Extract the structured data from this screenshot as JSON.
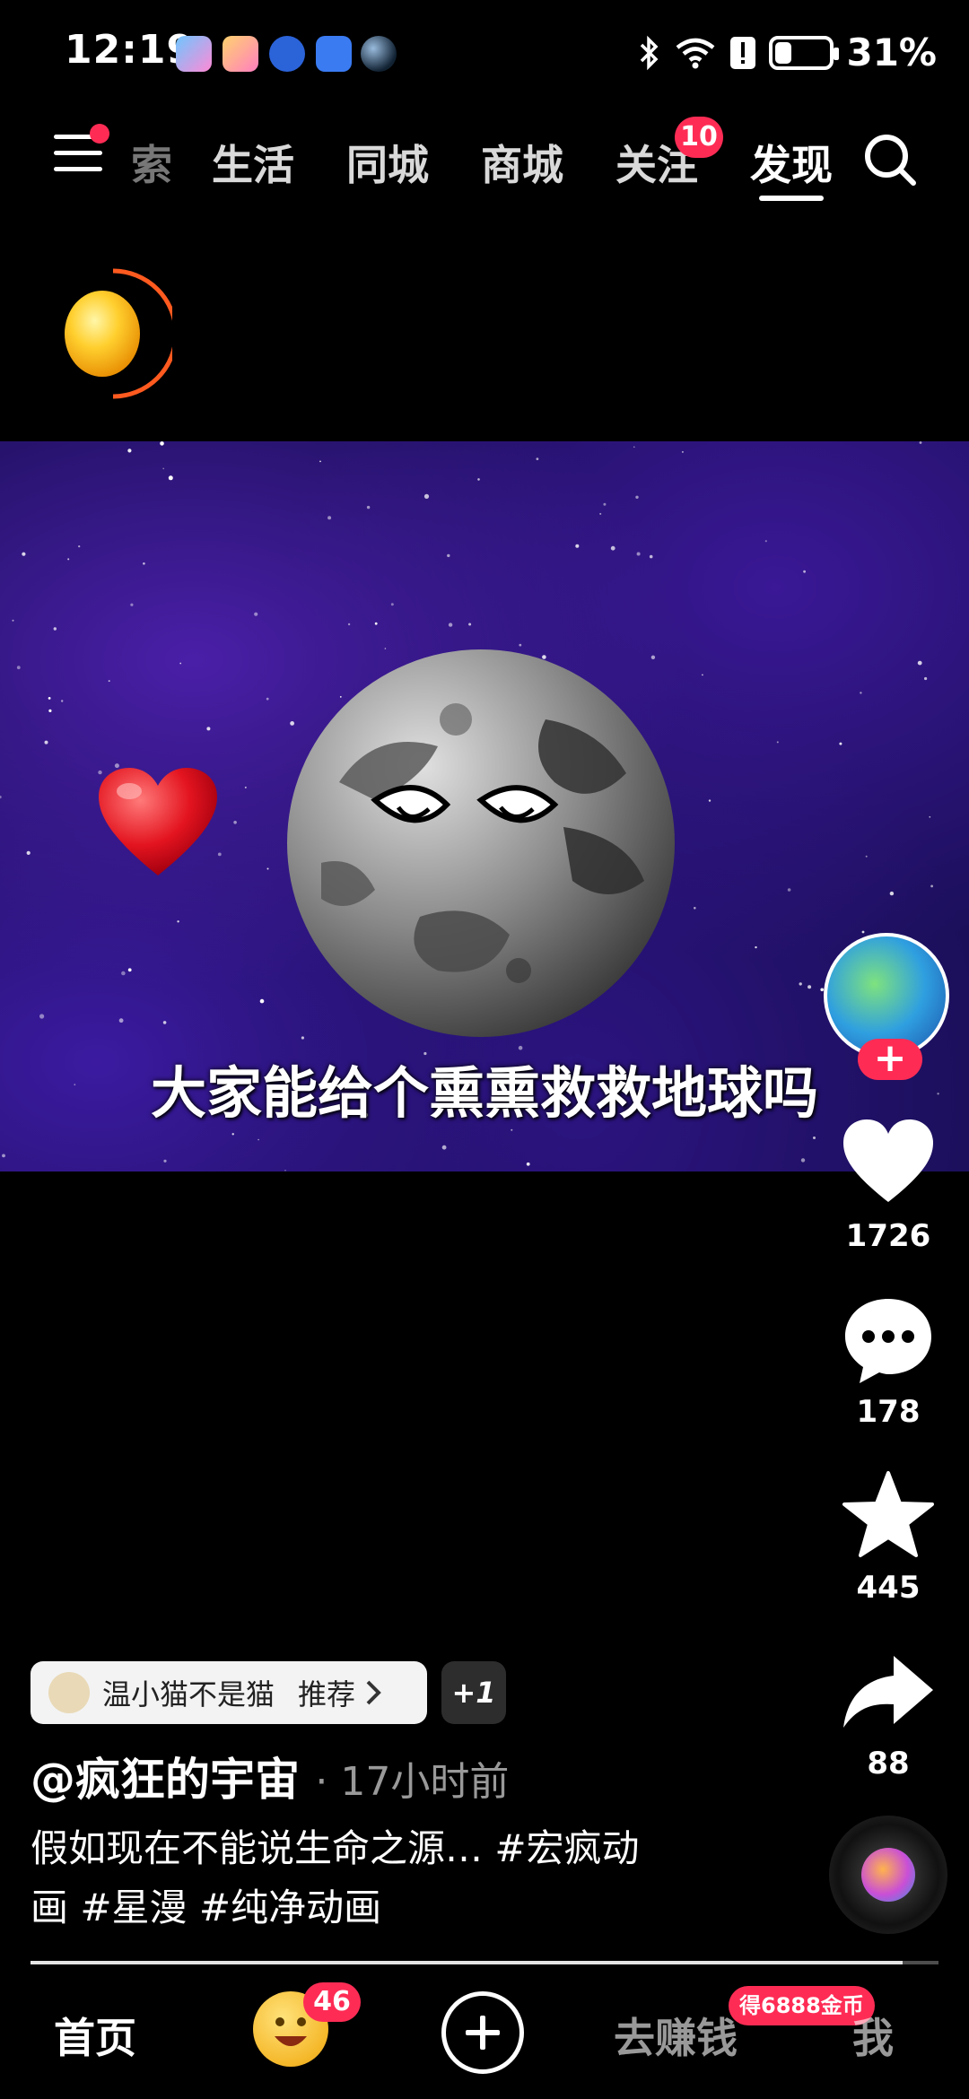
{
  "status_bar": {
    "time": "12:19",
    "battery": "31%",
    "battery_level": 0.31,
    "icons": [
      "game-app-icon",
      "game-app-icon",
      "robot-app-icon",
      "app-icon",
      "orb-app-icon",
      "bluetooth-icon",
      "wifi-icon",
      "alert-icon",
      "battery-icon"
    ]
  },
  "top_nav": {
    "tabs": [
      {
        "label": "索"
      },
      {
        "label": "生活"
      },
      {
        "label": "同城"
      },
      {
        "label": "商城"
      },
      {
        "label": "关注"
      },
      {
        "label": "发现"
      }
    ],
    "active_tab": "发现",
    "follow_badge": "10"
  },
  "video": {
    "subtitle": "大家能给个熏熏救救地球吗",
    "background_color": "#1b0f5a"
  },
  "actions": {
    "like_count": "1726",
    "comment_count": "178",
    "favorite_count": "445",
    "share_count": "88"
  },
  "info": {
    "recommend_user": "温小猫不是猫",
    "recommend_label": "推荐",
    "plus_one": "+1",
    "author": "@疯狂的宇宙",
    "time_ago": "· 17小时前",
    "description": "假如现在不能说生命之源… #宏疯动画 #星漫 #纯净动画",
    "progress": 0.96
  },
  "bottom_nav": {
    "home": "首页",
    "emoji_badge": "46",
    "earn": "去赚钱",
    "earn_badge": "得6888金币",
    "me": "我"
  },
  "colors": {
    "accent": "#fe2c55",
    "background": "#000000"
  }
}
